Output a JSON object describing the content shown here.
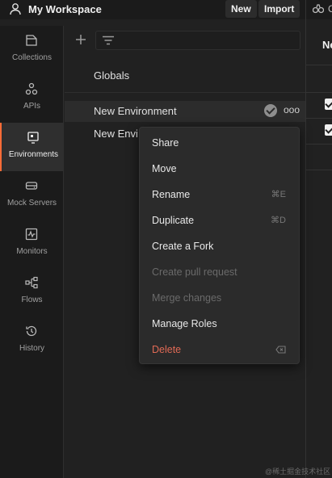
{
  "header": {
    "workspace_name": "My Workspace",
    "new_label": "New",
    "import_label": "Import",
    "user_icon": "user-icon"
  },
  "right_pane": {
    "tab_partial": "C",
    "title_partial": "Ne"
  },
  "sidebar": {
    "items": [
      {
        "label": "Collections",
        "icon": "collections-icon"
      },
      {
        "label": "APIs",
        "icon": "apis-icon"
      },
      {
        "label": "Environments",
        "icon": "environments-icon",
        "active": true
      },
      {
        "label": "Mock Servers",
        "icon": "mock-servers-icon"
      },
      {
        "label": "Monitors",
        "icon": "monitors-icon"
      },
      {
        "label": "Flows",
        "icon": "flows-icon"
      },
      {
        "label": "History",
        "icon": "history-icon"
      }
    ]
  },
  "list": {
    "globals_label": "Globals",
    "environments": [
      {
        "label": "New Environment",
        "active": true
      },
      {
        "label": "New Envi"
      }
    ]
  },
  "context_menu": {
    "items": [
      {
        "label": "Share"
      },
      {
        "label": "Move"
      },
      {
        "label": "Rename",
        "shortcut": "⌘E"
      },
      {
        "label": "Duplicate",
        "shortcut": "⌘D"
      },
      {
        "label": "Create a Fork"
      },
      {
        "label": "Create pull request",
        "disabled": true
      },
      {
        "label": "Merge changes",
        "disabled": true
      },
      {
        "label": "Manage Roles"
      },
      {
        "label": "Delete",
        "danger": true,
        "icon": "backspace-icon"
      }
    ]
  },
  "colors": {
    "accent": "#ff6c37",
    "danger": "#e06a55",
    "background": "#212121",
    "sidebar": "#1b1b1b"
  },
  "watermark": "@稀土掘金技术社区"
}
